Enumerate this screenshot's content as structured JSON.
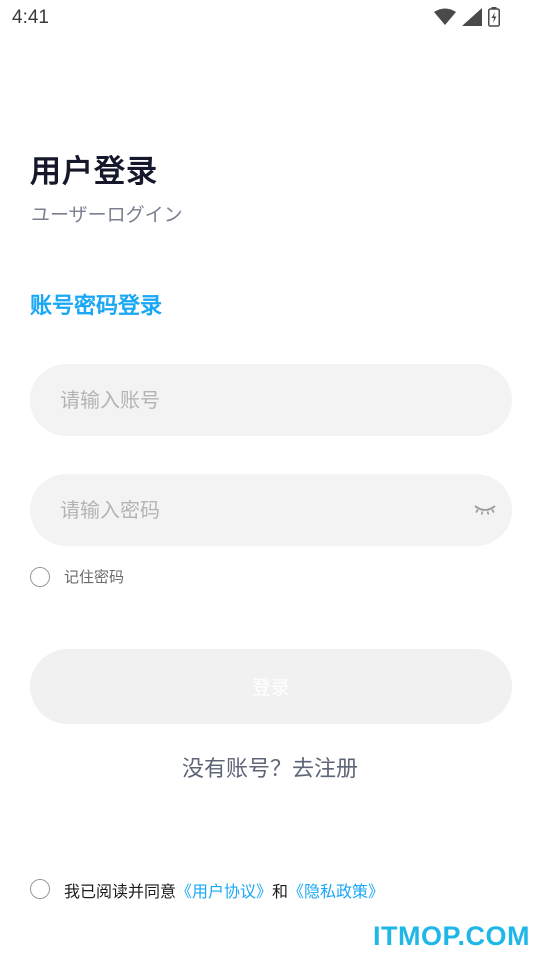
{
  "status_bar": {
    "time": "4:41",
    "icons": [
      "wifi-icon",
      "signal-icon",
      "battery-icon"
    ]
  },
  "header": {
    "title": "用户登录",
    "subtitle": "ユーザーログイン"
  },
  "login_mode": {
    "label": "账号密码登录"
  },
  "form": {
    "account_placeholder": "请输入账号",
    "account_value": "",
    "password_placeholder": "请输入密码",
    "password_value": "",
    "remember_label": "记住密码",
    "remember_checked": false,
    "login_label": "登录"
  },
  "register": {
    "label": "没有账号？去注册"
  },
  "agreement": {
    "prefix": "我已阅读并同意",
    "user_agreement": "《用户协议》",
    "conjunction": "和",
    "privacy_policy": "《隐私政策》",
    "checked": false
  },
  "watermark": {
    "text": "ITMOP.COM"
  },
  "colors": {
    "accent": "#1aa7f5",
    "title": "#15182b",
    "field_bg": "#f3f3f3",
    "button_bg": "#f1f1f1"
  }
}
